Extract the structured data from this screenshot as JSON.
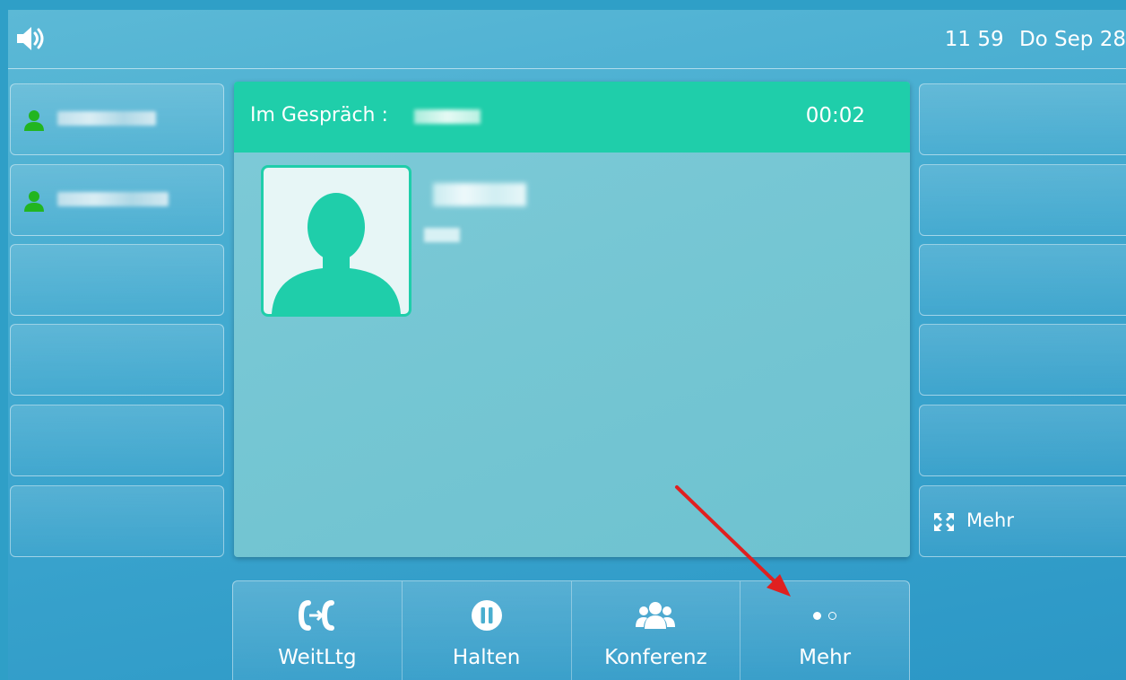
{
  "topbar": {
    "speaker_icon": "speaker-icon",
    "time": "11 59",
    "date": "Do Sep 28"
  },
  "line_keys_left": [
    {
      "type": "contact",
      "icon": "contact-icon",
      "label_blurred": true
    },
    {
      "type": "contact",
      "icon": "contact-icon",
      "label_blurred": true
    },
    {
      "type": "empty"
    },
    {
      "type": "empty"
    },
    {
      "type": "empty"
    },
    {
      "type": "empty"
    }
  ],
  "line_keys_right": [
    {
      "type": "empty"
    },
    {
      "type": "empty"
    },
    {
      "type": "empty"
    },
    {
      "type": "empty"
    },
    {
      "type": "empty"
    },
    {
      "type": "more",
      "icon": "expand-icon",
      "label": "Mehr"
    }
  ],
  "call": {
    "status_label": "Im Gespräch :",
    "timer": "00:02",
    "avatar_icon": "person-icon"
  },
  "softkeys": [
    {
      "icon": "transfer-icon",
      "label": "WeitLtg"
    },
    {
      "icon": "hold-icon",
      "label": "Halten"
    },
    {
      "icon": "conference-icon",
      "label": "Konferenz"
    },
    {
      "icon": "page-dots-icon",
      "label": "Mehr"
    }
  ],
  "colors": {
    "accent": "#1fceaa",
    "contact_green": "#22b520",
    "arrow_red": "#e02020"
  }
}
